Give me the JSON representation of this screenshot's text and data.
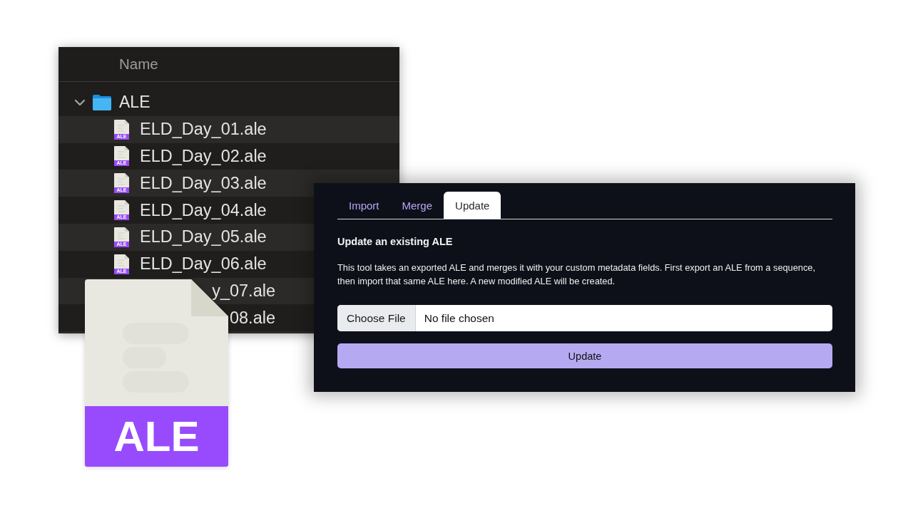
{
  "finder": {
    "column_header": "Name",
    "folder": {
      "name": "ALE",
      "expanded": true,
      "children": [
        {
          "kind": "file",
          "name": "ELD_Day_01.ale",
          "badge": "ALE"
        },
        {
          "kind": "file",
          "name": "ELD_Day_02.ale",
          "badge": "ALE"
        },
        {
          "kind": "file",
          "name": "ELD_Day_03.ale",
          "badge": "ALE"
        },
        {
          "kind": "file",
          "name": "ELD_Day_04.ale",
          "badge": "ALE"
        },
        {
          "kind": "file",
          "name": "ELD_Day_05.ale",
          "badge": "ALE"
        },
        {
          "kind": "file",
          "name": "ELD_Day_06.ale",
          "badge": "ALE"
        },
        {
          "kind": "partial",
          "name": "y_07.ale"
        },
        {
          "kind": "partial",
          "name": "08.ale"
        }
      ]
    }
  },
  "file_icon": {
    "label": "ALE"
  },
  "panel": {
    "tabs": [
      {
        "label": "Import",
        "selected": false
      },
      {
        "label": "Merge",
        "selected": false
      },
      {
        "label": "Update",
        "selected": true
      }
    ],
    "heading": "Update an existing ALE",
    "description": "This tool takes an exported ALE and merges it with your custom metadata fields. First export an ALE from a sequence, then import that same ALE here. A new modified ALE will be created.",
    "file_input": {
      "button": "Choose File",
      "status": "No file chosen"
    },
    "submit": "Update"
  }
}
